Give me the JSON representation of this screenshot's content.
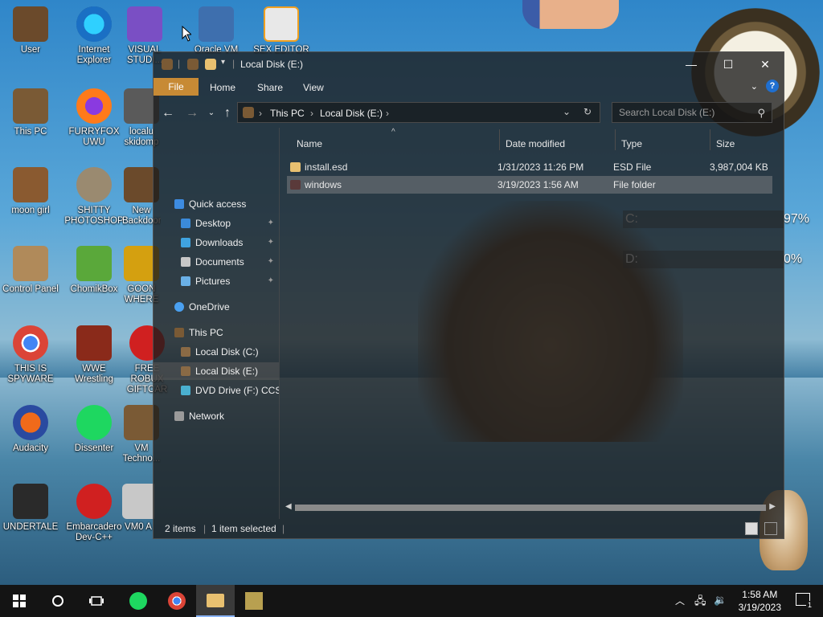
{
  "desktop": {
    "icons": [
      {
        "label": "User"
      },
      {
        "label": "Internet Explorer"
      },
      {
        "label": "VISUAL STUDI..."
      },
      {
        "label": "Oracle VM"
      },
      {
        "label": "SEX EDITOR"
      },
      {
        "label": "This PC"
      },
      {
        "label": "FURRYFOX UWU"
      },
      {
        "label": "localu skidomp"
      },
      {
        "label": "moon girl"
      },
      {
        "label": "SHITTY PHOTOSHOP"
      },
      {
        "label": "New Backdoor"
      },
      {
        "label": "Control Panel"
      },
      {
        "label": "ChomikBox"
      },
      {
        "label": "GOON WHERE"
      },
      {
        "label": "THIS IS SPYWARE"
      },
      {
        "label": "WWE Wrestling"
      },
      {
        "label": "FREE ROBUX GIFTCAR"
      },
      {
        "label": "Audacity"
      },
      {
        "label": "Dissenter"
      },
      {
        "label": "VM Techno..."
      },
      {
        "label": "UNDERTALE"
      },
      {
        "label": "Embarcadero Dev-C++"
      },
      {
        "label": "VM0 A"
      }
    ],
    "drive_gauges": [
      {
        "drive": "C:",
        "percent_text": "97%"
      },
      {
        "drive": "D:",
        "percent_text": "0%"
      }
    ]
  },
  "window": {
    "title": "Local Disk (E:)",
    "ribbon_tabs": [
      "File",
      "Home",
      "Share",
      "View"
    ],
    "address": {
      "crumbs": [
        "This PC",
        "Local Disk (E:)"
      ]
    },
    "search": {
      "placeholder": "Search Local Disk (E:)"
    },
    "nav": {
      "quick_access": "Quick access",
      "items": [
        {
          "label": "Desktop",
          "color": "#3b8ad9"
        },
        {
          "label": "Downloads",
          "color": "#3fa3e0"
        },
        {
          "label": "Documents",
          "color": "#c7c7c7"
        },
        {
          "label": "Pictures",
          "color": "#6ab0e6"
        }
      ],
      "onedrive": "OneDrive",
      "this_pc": "This PC",
      "drives": [
        {
          "label": "Local Disk (C:)"
        },
        {
          "label": "Local Disk (E:)"
        },
        {
          "label": "DVD Drive (F:) CCSA"
        }
      ],
      "network": "Network"
    },
    "columns": [
      "Name",
      "Date modified",
      "Type",
      "Size"
    ],
    "files": [
      {
        "name": "install.esd",
        "date": "1/31/2023 11:26 PM",
        "type": "ESD File",
        "size": "3,987,004 KB"
      },
      {
        "name": "windows",
        "date": "3/19/2023 1:56 AM",
        "type": "File folder",
        "size": ""
      }
    ],
    "status": {
      "count": "2 items",
      "selected": "1 item selected"
    }
  },
  "taskbar": {
    "time": "1:58 AM",
    "date": "3/19/2023",
    "notification_count": "1"
  }
}
